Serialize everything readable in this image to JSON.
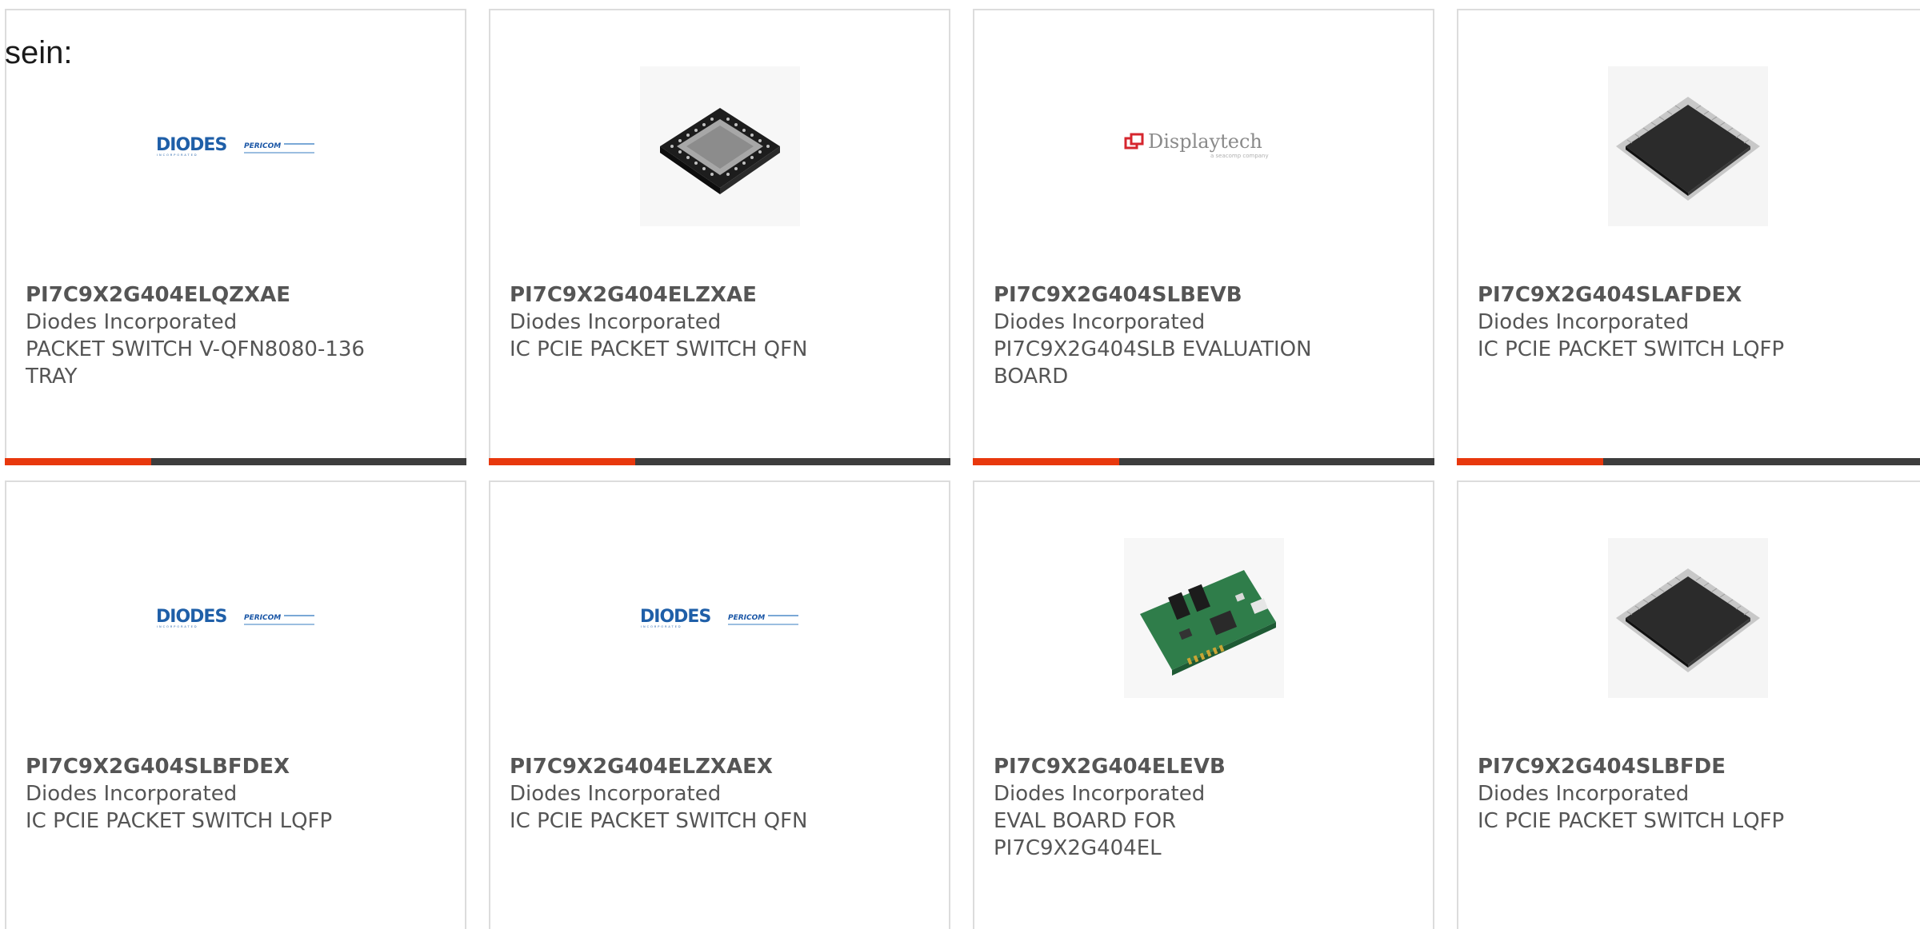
{
  "intro": "sein:",
  "colors": {
    "accent": "#e8380d",
    "bar": "#3d3d3d",
    "card_border": "#dcdcdc",
    "text": "#555555",
    "diodes_blue": "#1f5fa8",
    "displaytech_red": "#d6262e"
  },
  "products": [
    {
      "part": "PI7C9X2G404ELQZXAE",
      "manufacturer": "Diodes Incorporated",
      "description": "PACKET SWITCH V-QFN8080-136 TRAY",
      "image": "diodes-pericom-logo"
    },
    {
      "part": "PI7C9X2G404ELZXAE",
      "manufacturer": "Diodes Incorporated",
      "description": "IC PCIE PACKET SWITCH QFN",
      "image": "qfn-chip-photo"
    },
    {
      "part": "PI7C9X2G404SLBEVB",
      "manufacturer": "Diodes Incorporated",
      "description": "PI7C9X2G404SLB EVALUATION BOARD",
      "image": "displaytech-logo",
      "logo_text": "Displaytech",
      "logo_subtext": "a seacomp company"
    },
    {
      "part": "PI7C9X2G404SLAFDEX",
      "manufacturer": "Diodes Incorporated",
      "description": "IC PCIE PACKET SWITCH LQFP",
      "image": "lqfp-chip-photo"
    },
    {
      "part": "PI7C9X2G404SLBFDEX",
      "manufacturer": "Diodes Incorporated",
      "description": "IC PCIE PACKET SWITCH LQFP",
      "image": "diodes-pericom-logo"
    },
    {
      "part": "PI7C9X2G404ELZXAEX",
      "manufacturer": "Diodes Incorporated",
      "description": "IC PCIE PACKET SWITCH QFN",
      "image": "diodes-pericom-logo"
    },
    {
      "part": "PI7C9X2G404ELEVB",
      "manufacturer": "Diodes Incorporated",
      "description": "EVAL BOARD FOR PI7C9X2G404EL",
      "image": "eval-board-photo"
    },
    {
      "part": "PI7C9X2G404SLBFDE",
      "manufacturer": "Diodes Incorporated",
      "description": "IC PCIE PACKET SWITCH LQFP",
      "image": "lqfp-chip-photo"
    }
  ]
}
